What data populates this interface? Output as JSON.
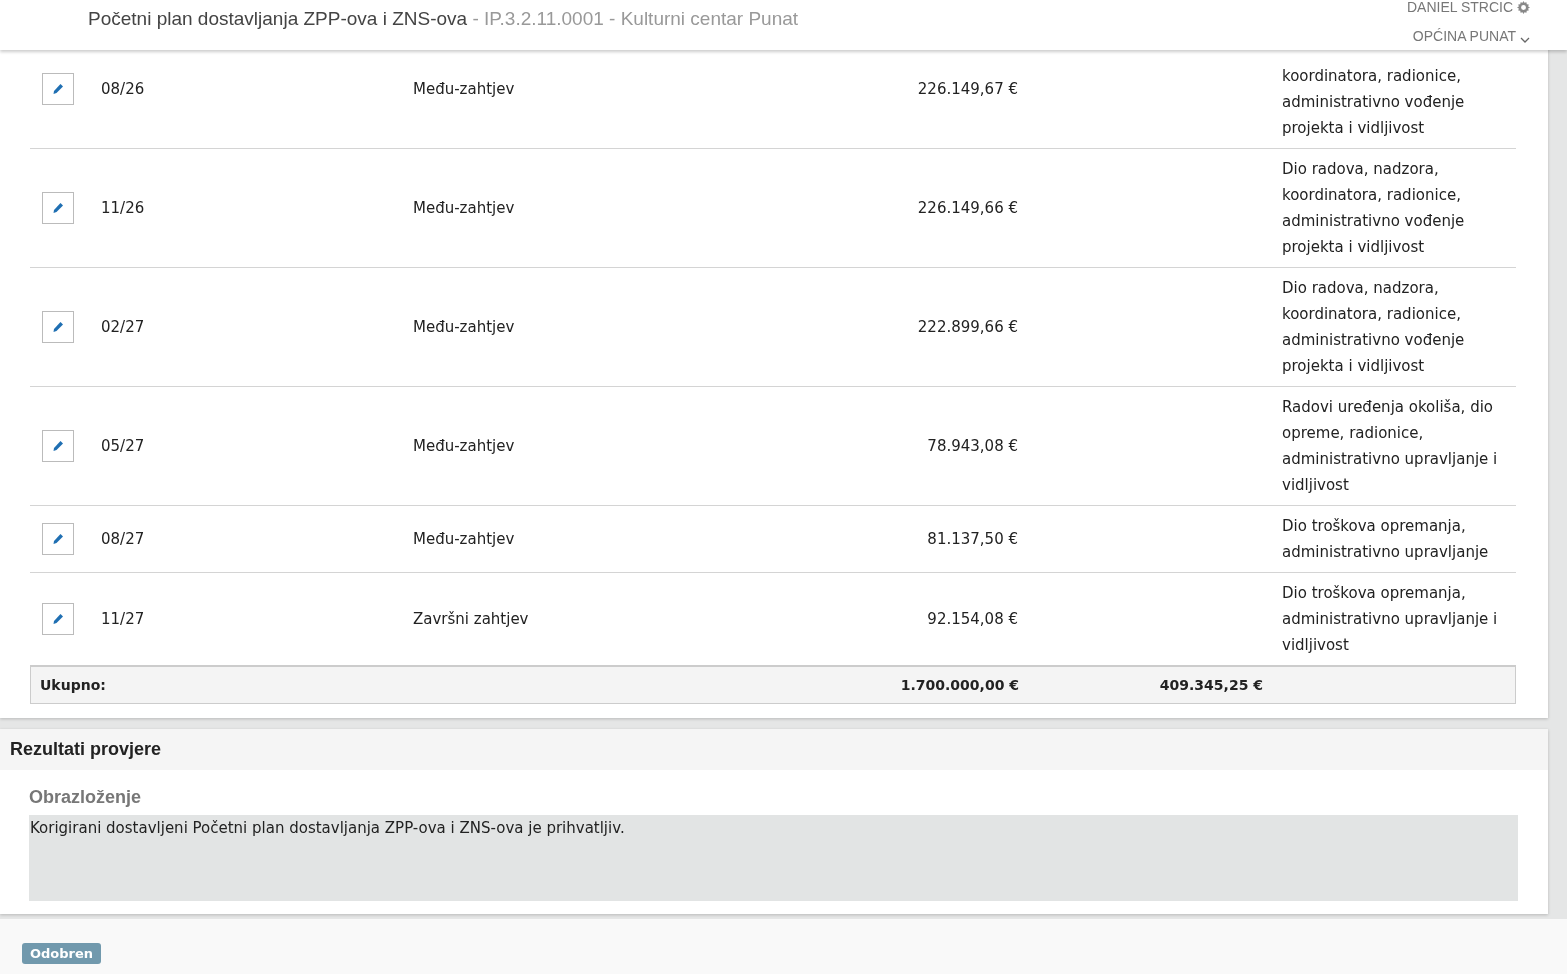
{
  "header": {
    "title": "Početni plan dostavljanja ZPP-ova i ZNS-ova",
    "subtitle": "- IP.3.2.11.0001 - Kulturni centar Punat",
    "user": "DANIEL STRCIC",
    "organization": "OPĆINA PUNAT"
  },
  "table": {
    "rows": [
      {
        "period": "08/26",
        "type": "Među-zahtjev",
        "amount": "226.149,67 €",
        "note": "koordinatora, radionice, administrativno vođenje projekta i vidljivost"
      },
      {
        "period": "11/26",
        "type": "Među-zahtjev",
        "amount": "226.149,66 €",
        "note": "Dio radova, nadzora, koordinatora, radionice, administrativno vođenje projekta i vidljivost"
      },
      {
        "period": "02/27",
        "type": "Među-zahtjev",
        "amount": "222.899,66 €",
        "note": "Dio radova, nadzora, koordinatora, radionice, administrativno vođenje projekta i vidljivost"
      },
      {
        "period": "05/27",
        "type": "Među-zahtjev",
        "amount": "78.943,08 €",
        "note": "Radovi uređenja okoliša, dio opreme, radionice, administrativno upravljanje i vidljivost"
      },
      {
        "period": "08/27",
        "type": "Među-zahtjev",
        "amount": "81.137,50 €",
        "note": "Dio troškova opremanja, administrativno upravljanje"
      },
      {
        "period": "11/27",
        "type": "Završni zahtjev",
        "amount": "92.154,08 €",
        "note": "Dio troškova opremanja, administrativno upravljanje i vidljivost"
      }
    ],
    "total": {
      "label": "Ukupno:",
      "amount": "1.700.000,00 €",
      "column_4": "409.345,25 €"
    }
  },
  "results": {
    "title": "Rezultati provjere",
    "field_label": "Obrazloženje",
    "field_value": "Korigirani dostavljeni Početni plan dostavljanja ZPP-ova i ZNS-ova je prihvatljiv."
  },
  "status_badge": "Odobren"
}
